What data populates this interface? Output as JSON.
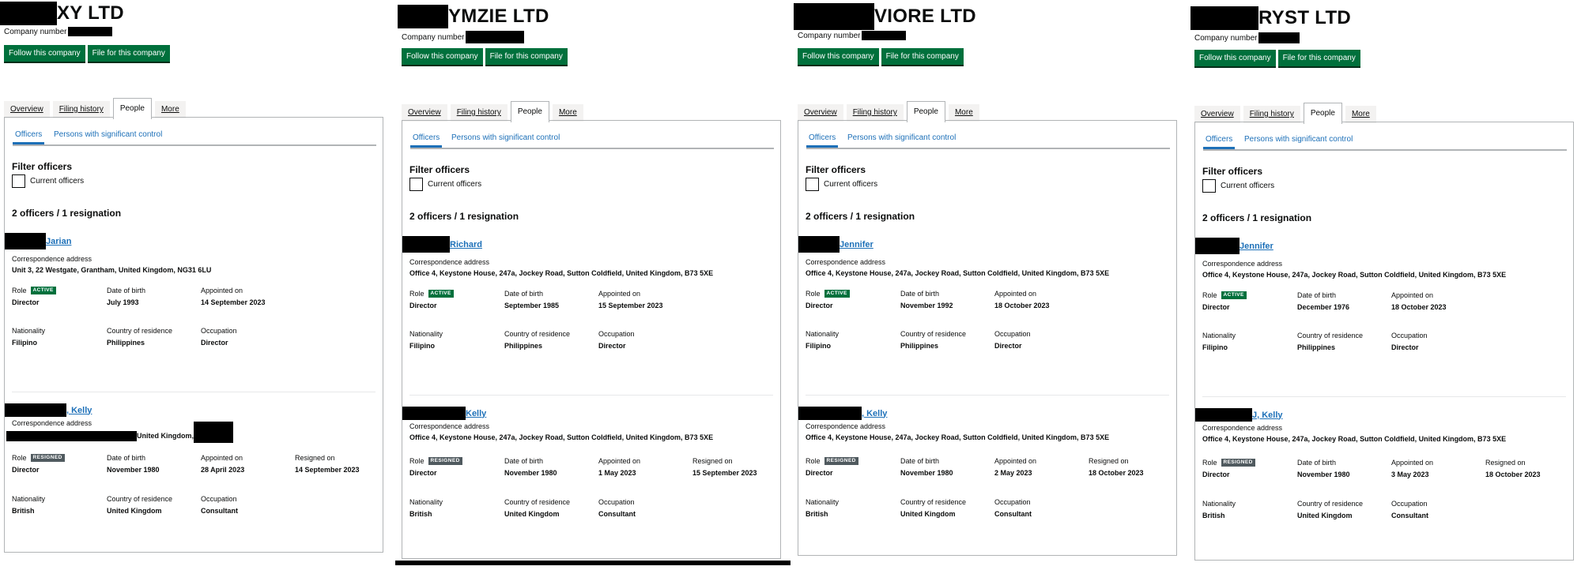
{
  "common": {
    "company_number_label": "Company number",
    "follow_button": "Follow this company",
    "file_button": "File for this company",
    "tabs": [
      "Overview",
      "Filing history",
      "People",
      "More"
    ],
    "subtabs": [
      "Officers",
      "Persons with significant control"
    ],
    "filter_heading": "Filter officers",
    "current_officers_label": "Current officers",
    "officers_count": "2 officers / 1 resignation",
    "correspondence_label": "Correspondence address",
    "role_label": "Role",
    "dob_label": "Date of birth",
    "appointed_label": "Appointed on",
    "resigned_label": "Resigned on",
    "nationality_label": "Nationality",
    "residence_label": "Country of residence",
    "occupation_label": "Occupation",
    "active_tag": "ACTIVE",
    "resigned_tag": "RESIGNED"
  },
  "panels": [
    {
      "company_name": "XY LTD",
      "officer1": {
        "name": "Jarian",
        "address": "Unit 3, 22 Westgate, Grantham, United Kingdom, NG31 6LU",
        "role": "Director",
        "dob": "July 1993",
        "appointed": "14 September 2023",
        "nationality": "Filipino",
        "residence": "Philippines",
        "occupation": "Director"
      },
      "officer2": {
        "name": ", Kelly",
        "address": "United Kingdom, ",
        "role": "Director",
        "dob": "November 1980",
        "appointed": "28 April 2023",
        "resigned": "14 September 2023",
        "nationality": "British",
        "residence": "United Kingdom",
        "occupation": "Consultant"
      }
    },
    {
      "company_name": "YMZIE LTD",
      "officer1": {
        "name": " Richard",
        "address": "Office 4, Keystone House, 247a, Jockey Road, Sutton Coldfield, United Kingdom, B73 5XE",
        "role": "Director",
        "dob": "September 1985",
        "appointed": "15 September 2023",
        "nationality": "Filipino",
        "residence": "Philippines",
        "occupation": "Director"
      },
      "officer2": {
        "name": " Kelly",
        "address": "Office 4, Keystone House, 247a, Jockey Road, Sutton Coldfield, United Kingdom, B73 5XE",
        "role": "Director",
        "dob": "November 1980",
        "appointed": "1 May 2023",
        "resigned": "15 September 2023",
        "nationality": "British",
        "residence": "United Kingdom",
        "occupation": "Consultant"
      }
    },
    {
      "company_name": "VIORE LTD",
      "officer1": {
        "name": "Jennifer",
        "address": "Office 4, Keystone House, 247a, Jockey Road, Sutton Coldfield, United Kingdom, B73 5XE",
        "role": "Director",
        "dob": "November 1992",
        "appointed": "18 October 2023",
        "nationality": "Filipino",
        "residence": "Philippines",
        "occupation": "Director"
      },
      "officer2": {
        "name": ", Kelly",
        "address": "Office 4, Keystone House, 247a, Jockey Road, Sutton Coldfield, United Kingdom, B73 5XE",
        "role": "Director",
        "dob": "November 1980",
        "appointed": "2 May 2023",
        "resigned": "18 October 2023",
        "nationality": "British",
        "residence": "United Kingdom",
        "occupation": "Consultant"
      }
    },
    {
      "company_name": "RYST LTD",
      "officer1": {
        "name": " Jennifer",
        "address": "Office 4, Keystone House, 247a, Jockey Road, Sutton Coldfield, United Kingdom, B73 5XE",
        "role": "Director",
        "dob": "December 1976",
        "appointed": "18 October 2023",
        "nationality": "Filipino",
        "residence": "Philippines",
        "occupation": "Director"
      },
      "officer2": {
        "name": "J, Kelly",
        "address": "Office 4, Keystone House, 247a, Jockey Road, Sutton Coldfield, United Kingdom, B73 5XE",
        "role": "Director",
        "dob": "November 1980",
        "appointed": "3 May 2023",
        "resigned": "18 October 2023",
        "nationality": "British",
        "residence": "United Kingdom",
        "occupation": "Consultant"
      }
    }
  ]
}
